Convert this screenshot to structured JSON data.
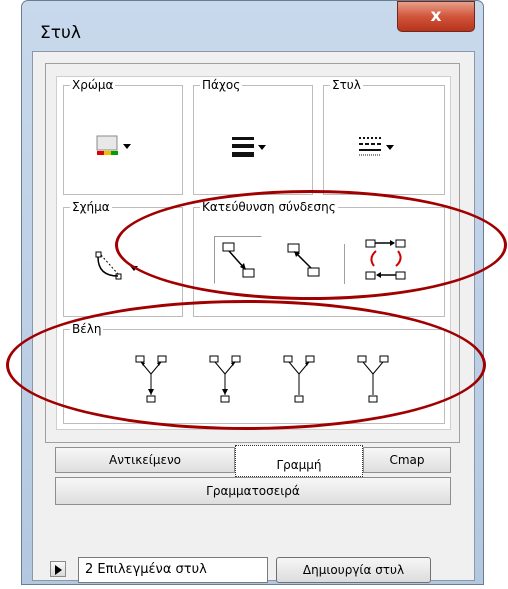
{
  "window": {
    "title": "Στυλ",
    "close_label": "x"
  },
  "groups": {
    "color": "Χρώμα",
    "thickness": "Πάχος",
    "style": "Στυλ",
    "shape": "Σχήμα",
    "direction": "Κατεύθυνση σύνδεσης",
    "arrows": "Βέλη"
  },
  "tabs": {
    "object": "Αντικείμενο",
    "line": "Γραμμή",
    "cmap": "Cmap",
    "font": "Γραμματοσειρά"
  },
  "footer": {
    "styles_value": "2 Επιλεγμένα στυλ",
    "create_button": "Δημιουργία στυλ"
  },
  "colors": {
    "annotation": "#a00000",
    "color_swatch": [
      "#e00000",
      "#f0c000",
      "#00a000"
    ]
  }
}
